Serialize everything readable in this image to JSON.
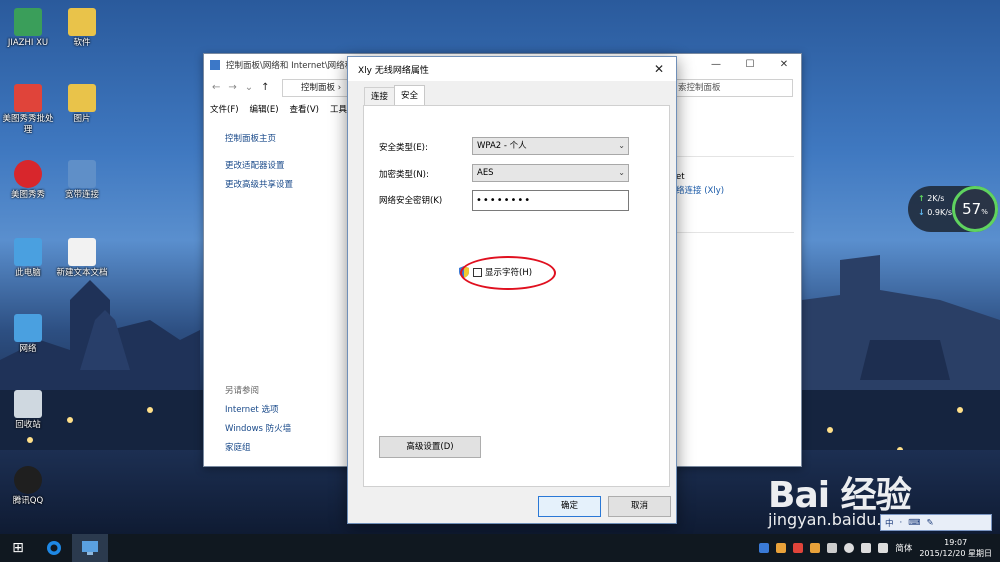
{
  "desktop": {
    "icons": [
      {
        "label": "JIAZHI XU",
        "color": "#3a9e5a"
      },
      {
        "label": "软件",
        "color": "#e9c34a"
      },
      {
        "label": "美图秀秀批处理",
        "color": "#e0443a"
      },
      {
        "label": "图片",
        "color": "#e9c34a"
      },
      {
        "label": "美图秀秀",
        "color": "#d8262c"
      },
      {
        "label": "宽带连接",
        "color": "#5f8fc8"
      },
      {
        "label": "此电脑",
        "color": "#4aa0e0"
      },
      {
        "label": "新建文本文档",
        "color": "#f2f2f2"
      },
      {
        "label": "网络",
        "color": "#4aa0e0"
      },
      {
        "label": "回收站",
        "color": "#cfd8e0"
      },
      {
        "label": "腾讯QQ",
        "color": "#1f1f1f"
      }
    ]
  },
  "control_panel": {
    "title": "控制面板\\网络和 Internet\\网络和...",
    "address": "控制面板 ›",
    "search_placeholder": "索控制面板",
    "menu": [
      "文件(F)",
      "编辑(E)",
      "查看(V)",
      "工具"
    ],
    "sidebar": {
      "home": "控制面板主页",
      "links": [
        "更改适配器设置",
        "更改高级共享设置"
      ],
      "see_also_label": "另请参阅",
      "see_also": [
        "Internet 选项",
        "Windows 防火墙",
        "家庭组"
      ]
    },
    "right": {
      "line1": "et",
      "link": "络连接 (Xly)"
    }
  },
  "dialog": {
    "title": "Xly 无线网络属性",
    "close": "✕",
    "tabs": [
      "连接",
      "安全"
    ],
    "active_tab": "安全",
    "security_type_label": "安全类型(E):",
    "security_type_value": "WPA2 - 个人",
    "encryption_label": "加密类型(N):",
    "encryption_value": "AES",
    "key_label": "网络安全密钥(K)",
    "key_value": "••••••••",
    "show_chars_label": "显示字符(H)",
    "show_chars_checked": false,
    "advanced_button": "高级设置(D)",
    "ok_button": "确定",
    "cancel_button": "取消"
  },
  "speed_widget": {
    "up": "2K/s",
    "down": "0.9K/s",
    "percent": "57",
    "unit": "%"
  },
  "watermark": {
    "logo": "Bai  经验",
    "url": "jingyan.baidu.com"
  },
  "ime": {
    "items": [
      "中",
      "·",
      "⌨",
      "✎"
    ]
  },
  "taskbar": {
    "start": "⊞",
    "tray_lang": "简体",
    "time": "19:07",
    "date": "2015/12/20 星期日"
  }
}
